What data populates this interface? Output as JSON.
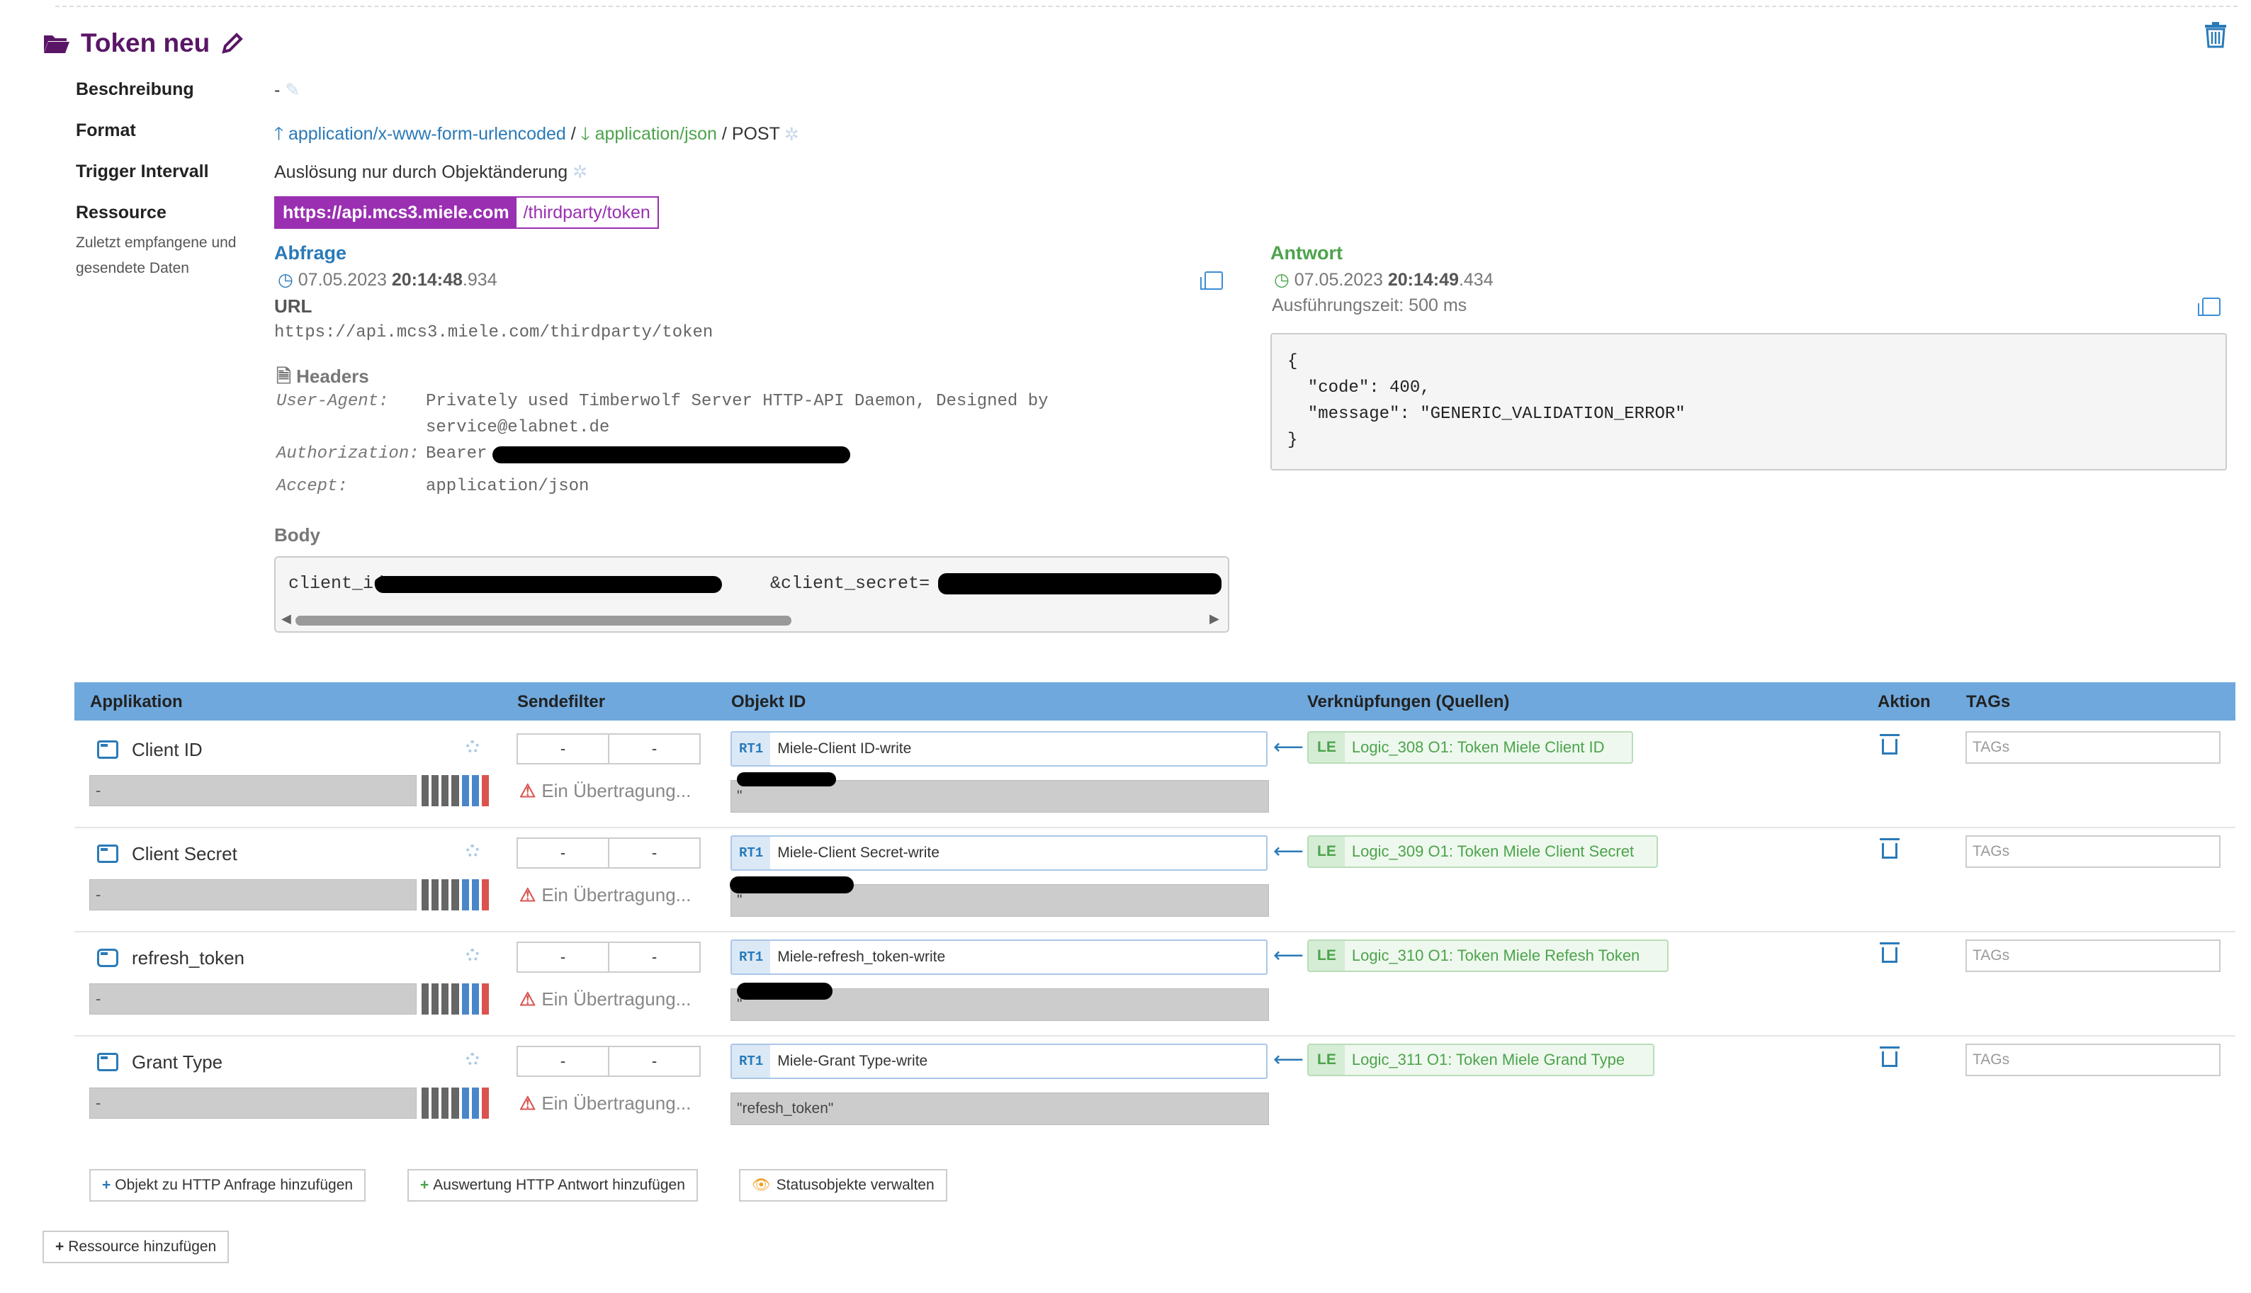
{
  "header": {
    "title": "Token neu"
  },
  "props": {
    "beschreibung_label": "Beschreibung",
    "beschreibung_value": "-",
    "format_label": "Format",
    "format_in": "application/x-www-form-urlencoded",
    "format_sep": "/",
    "format_out": "application/json",
    "format_method": "/ POST",
    "trigger_label": "Trigger Intervall",
    "trigger_value": "Auslösung nur durch Objektänderung",
    "ressource_label": "Ressource",
    "ressource_host": "https://api.mcs3.miele.com",
    "ressource_path": "/thirdparty/token",
    "ressource_note": "Zuletzt empfangene und gesendete Daten"
  },
  "request": {
    "heading": "Abfrage",
    "date": "07.05.2023",
    "time": "20:14:48",
    "ms": ".934",
    "url_label": "URL",
    "url": "https://api.mcs3.miele.com/thirdparty/token",
    "headers_label": "Headers",
    "headers": [
      {
        "key": "User-Agent:",
        "value": "Privately used Timberwolf Server HTTP-API Daemon, Designed by"
      },
      {
        "key": "",
        "value": "service@elabnet.de"
      },
      {
        "key": "Authorization:",
        "value": "Bearer"
      },
      {
        "key": "Accept:",
        "value": "application/json"
      }
    ],
    "body_label": "Body",
    "body_start": "client_id=",
    "body_mid": "&client_secret="
  },
  "response": {
    "heading": "Antwort",
    "date": "07.05.2023",
    "time": "20:14:49",
    "ms": ".434",
    "exec_time": "Ausführungszeit: 500 ms",
    "body": "{\n  \"code\": 400,\n  \"message\": \"GENERIC_VALIDATION_ERROR\"\n}"
  },
  "table": {
    "columns": [
      "Applikation",
      "Sendefilter",
      "Objekt ID",
      "Verknüpfungen (Quellen)",
      "Aktion",
      "TAGs"
    ],
    "rows": [
      {
        "name": "Client ID",
        "sf_a": "-",
        "sf_b": "-",
        "warn": "Ein Übertragung...",
        "rt": "RT1",
        "object": "Miele-Client ID-write",
        "value": "\"",
        "le": "LE",
        "link": "Logic_308 O1: Token Miele Client ID",
        "tags_placeholder": "TAGs",
        "bar_value": "-"
      },
      {
        "name": "Client Secret",
        "sf_a": "-",
        "sf_b": "-",
        "warn": "Ein Übertragung...",
        "rt": "RT1",
        "object": "Miele-Client Secret-write",
        "value": "\"",
        "le": "LE",
        "link": "Logic_309 O1: Token Miele Client Secret",
        "tags_placeholder": "TAGs",
        "bar_value": "-"
      },
      {
        "name": "refresh_token",
        "sf_a": "-",
        "sf_b": "-",
        "warn": "Ein Übertragung...",
        "rt": "RT1",
        "object": "Miele-refresh_token-write",
        "value": "\"",
        "le": "LE",
        "link": "Logic_310 O1: Token Miele Refesh Token",
        "tags_placeholder": "TAGs",
        "bar_value": "-"
      },
      {
        "name": "Grant Type",
        "sf_a": "-",
        "sf_b": "-",
        "warn": "Ein Übertragung...",
        "rt": "RT1",
        "object": "Miele-Grant Type-write",
        "value": "\"refesh_token\"",
        "le": "LE",
        "link": "Logic_311 O1: Token Miele Grand Type",
        "tags_placeholder": "TAGs",
        "bar_value": "-"
      }
    ]
  },
  "buttons": {
    "add_object": "Objekt zu HTTP Anfrage hinzufügen",
    "add_eval": "Auswertung HTTP Antwort hinzufügen",
    "status_objects": "Statusobjekte verwalten",
    "add_resource": "Ressource hinzufügen"
  },
  "colors": {
    "accent": "#9a2fb2",
    "table_header": "#6fa8dc",
    "link_green": "#4da34d",
    "link_blue": "#2a7ab8"
  },
  "icons": [
    "folder-open-icon",
    "pencil-icon",
    "trash-icon",
    "copy-icon",
    "clock-icon",
    "file-icon",
    "gear-icon",
    "warning-icon",
    "arrow-left-icon",
    "plus-icon",
    "eye-icon",
    "music-icon"
  ]
}
